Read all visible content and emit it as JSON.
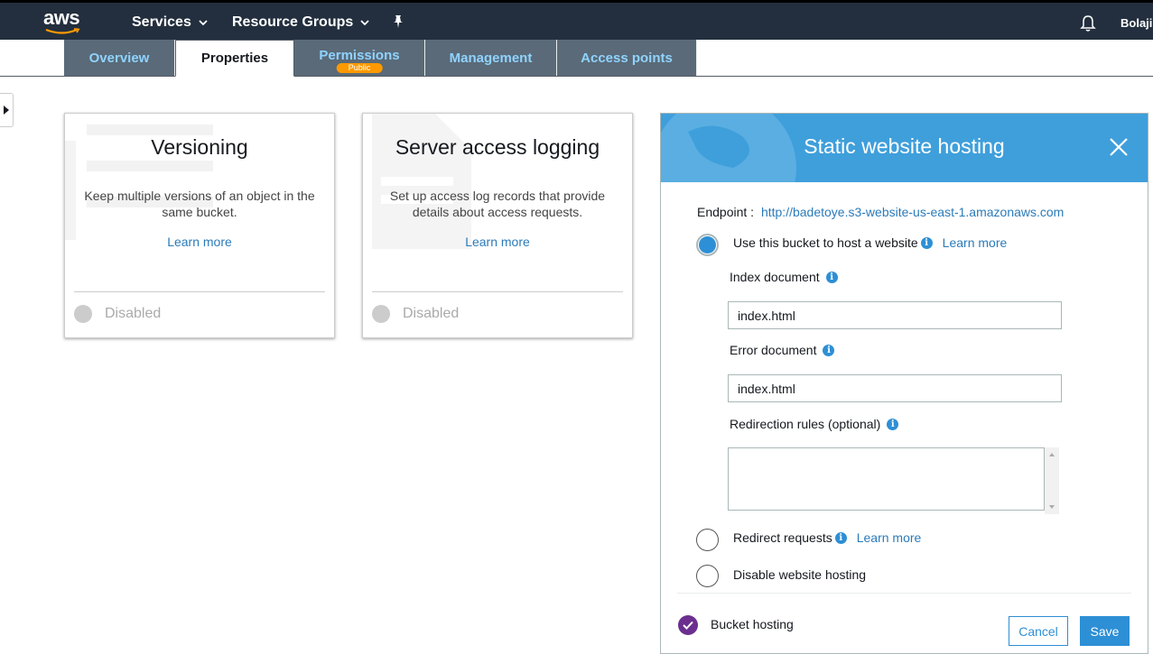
{
  "topnav": {
    "logo": "aws",
    "services": "Services",
    "resource_groups": "Resource Groups",
    "user": "Bolaji",
    "icons": [
      "pin-icon",
      "bell-icon",
      "chevron-down-icon"
    ]
  },
  "tabs": [
    {
      "label": "Overview"
    },
    {
      "label": "Properties",
      "active": true
    },
    {
      "label": "Permissions",
      "badge": "Public"
    },
    {
      "label": "Management"
    },
    {
      "label": "Access points"
    }
  ],
  "cards": [
    {
      "title": "Versioning",
      "description": "Keep multiple versions of an object in the same bucket.",
      "link": "Learn more",
      "status": "Disabled"
    },
    {
      "title": "Server access logging",
      "description": "Set up access log records that provide details about access requests.",
      "link": "Learn more",
      "status": "Disabled"
    }
  ],
  "panel": {
    "title": "Static website hosting",
    "endpoint_label": "Endpoint :",
    "endpoint_url": "http://badetoye.s3-website-us-east-1.amazonaws.com",
    "options": [
      {
        "label": "Use this bucket to host a website",
        "link": "Learn more",
        "selected": true
      },
      {
        "label": "Redirect requests",
        "link": "Learn more",
        "selected": false
      },
      {
        "label": "Disable website hosting",
        "selected": false
      }
    ],
    "index_label": "Index document",
    "index_value": "index.html",
    "error_label": "Error document",
    "error_value": "index.html",
    "redirection_label": "Redirection rules (optional)",
    "redirection_value": "",
    "footer_label": "Bucket hosting",
    "cancel": "Cancel",
    "save": "Save"
  },
  "colors": {
    "nav_bg": "#232f3e",
    "accent": "#2d8fd5",
    "badge": "#ff9900",
    "panel_head": "#3f9fdb",
    "check": "#6b2f8f"
  }
}
